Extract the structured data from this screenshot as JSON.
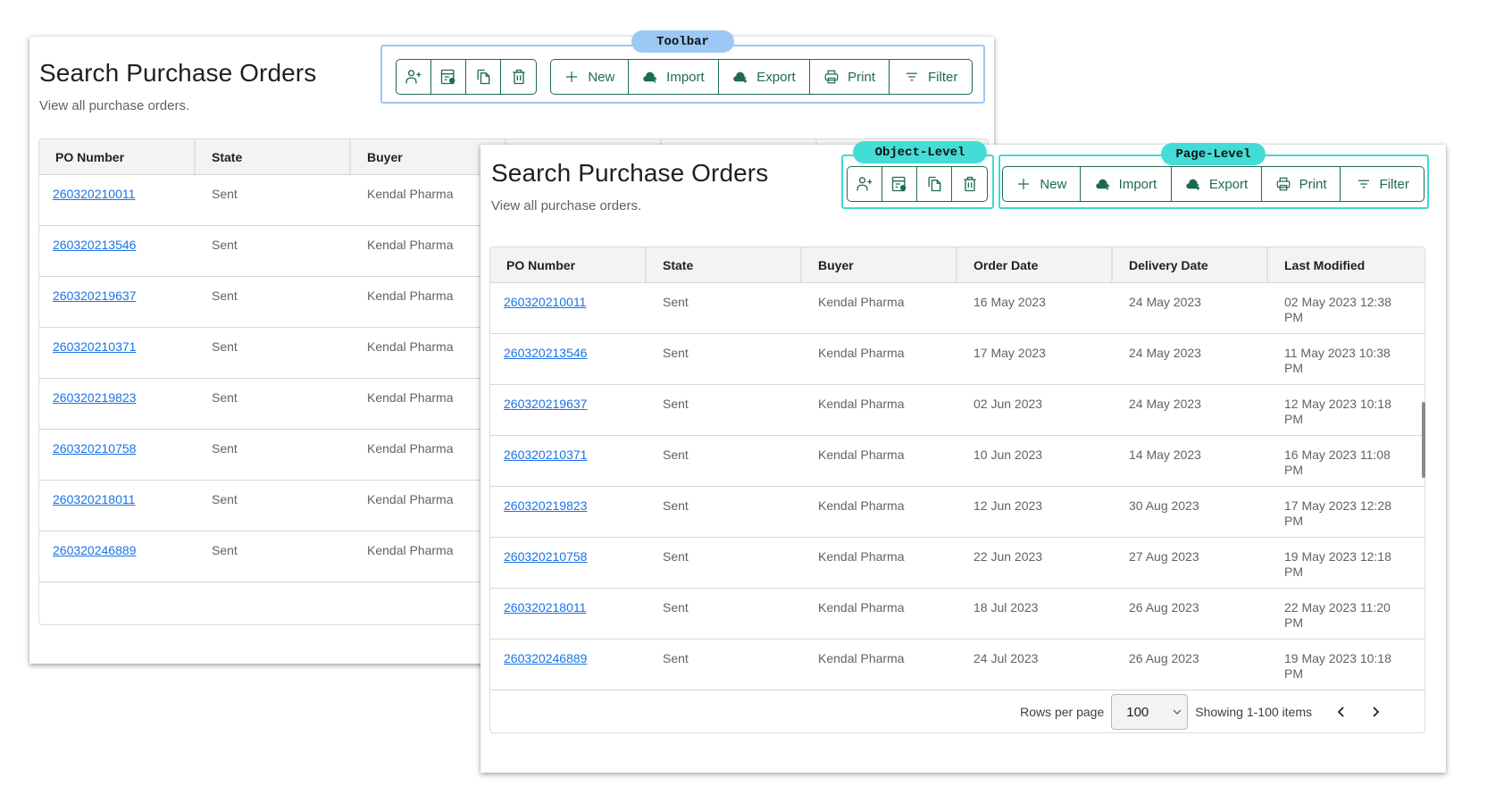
{
  "page": {
    "title": "Search Purchase Orders",
    "subtitle": "View all purchase orders."
  },
  "annotations": {
    "toolbar": "Toolbar",
    "object_level": "Object-Level",
    "page_level": "Page-Level",
    "colors": {
      "toolbar": "#9cc8f5",
      "object_level": "#44dcd6",
      "page_level": "#44dcd6",
      "button_accent": "#1d6b4f",
      "link": "#1a73e8"
    }
  },
  "toolbar": {
    "object_actions": [
      {
        "icon": "person-add-icon",
        "label": "Add user"
      },
      {
        "icon": "form-view-icon",
        "label": "View details"
      },
      {
        "icon": "copy-icon",
        "label": "Copy"
      },
      {
        "icon": "trash-icon",
        "label": "Delete"
      }
    ],
    "page_actions": [
      {
        "icon": "plus-icon",
        "label": "New"
      },
      {
        "icon": "cloud-upload-icon",
        "label": "Import"
      },
      {
        "icon": "cloud-download-icon",
        "label": "Export"
      },
      {
        "icon": "printer-icon",
        "label": "Print"
      },
      {
        "icon": "filter-icon",
        "label": "Filter"
      }
    ]
  },
  "table": {
    "columns": [
      "PO Number",
      "State",
      "Buyer",
      "Order Date",
      "Delivery Date",
      "Last Modified"
    ],
    "rows": [
      {
        "po": "260320210011",
        "state": "Sent",
        "buyer": "Kendal Pharma",
        "order_date": "16 May 2023",
        "delivery_date": "24 May 2023",
        "last_modified": "02 May 2023 12:38 PM"
      },
      {
        "po": "260320213546",
        "state": "Sent",
        "buyer": "Kendal Pharma",
        "order_date": "17 May 2023",
        "delivery_date": "24 May 2023",
        "last_modified": "11 May 2023 10:38 PM"
      },
      {
        "po": "260320219637",
        "state": "Sent",
        "buyer": "Kendal Pharma",
        "order_date": "02 Jun 2023",
        "delivery_date": "24 May 2023",
        "last_modified": "12 May 2023 10:18 PM"
      },
      {
        "po": "260320210371",
        "state": "Sent",
        "buyer": "Kendal Pharma",
        "order_date": "10 Jun 2023",
        "delivery_date": "14 May 2023",
        "last_modified": "16 May 2023 11:08 PM"
      },
      {
        "po": "260320219823",
        "state": "Sent",
        "buyer": "Kendal Pharma",
        "order_date": "12 Jun 2023",
        "delivery_date": "30 Aug 2023",
        "last_modified": "17 May 2023 12:28 PM"
      },
      {
        "po": "260320210758",
        "state": "Sent",
        "buyer": "Kendal Pharma",
        "order_date": "22 Jun 2023",
        "delivery_date": "27 Aug 2023",
        "last_modified": "19 May 2023 12:18 PM"
      },
      {
        "po": "260320218011",
        "state": "Sent",
        "buyer": "Kendal Pharma",
        "order_date": "18 Jul 2023",
        "delivery_date": "26 Aug 2023",
        "last_modified": "22 May 2023 11:20 PM"
      },
      {
        "po": "260320246889",
        "state": "Sent",
        "buyer": "Kendal Pharma",
        "order_date": "24 Jul 2023",
        "delivery_date": "26 Aug 2023",
        "last_modified": "19 May 2023 10:18 PM"
      }
    ]
  },
  "pagination": {
    "rows_per_page_label": "Rows per page",
    "rows_per_page_value": "100",
    "showing_text": "Showing 1-100 items"
  }
}
